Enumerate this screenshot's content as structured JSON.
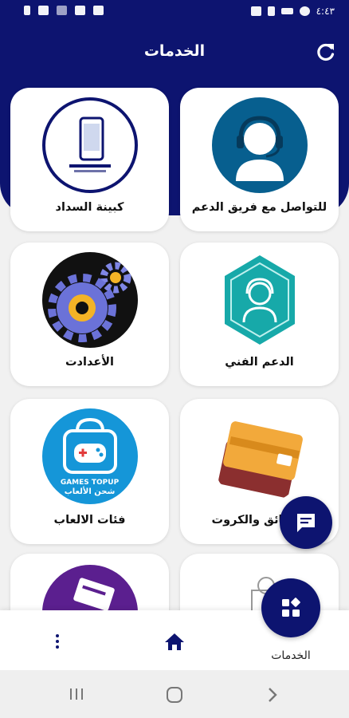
{
  "status_bar": {
    "time": "٤:٤٣"
  },
  "header": {
    "title": "الخدمات"
  },
  "cards": [
    {
      "label": "للتواصل مع فريق الدعم",
      "icon": "headset-support-icon"
    },
    {
      "label": "كبينة السداد",
      "icon": "payment-kiosk-logo"
    },
    {
      "label": "الدعم الفني",
      "icon": "technical-support-icon"
    },
    {
      "label": "الأعدادت",
      "icon": "settings-gears-icon"
    },
    {
      "label": "البطائق والكروت",
      "icon": "cards-icon"
    },
    {
      "label": "فئات الالعاب",
      "icon": "games-topup-icon",
      "logo_text": [
        "GAMES TOPUP",
        "شحن الألعاب"
      ]
    }
  ],
  "bottom_nav": {
    "services_label": "الخدمات"
  },
  "colors": {
    "primary": "#0d1470",
    "background": "#f1f1f1"
  }
}
